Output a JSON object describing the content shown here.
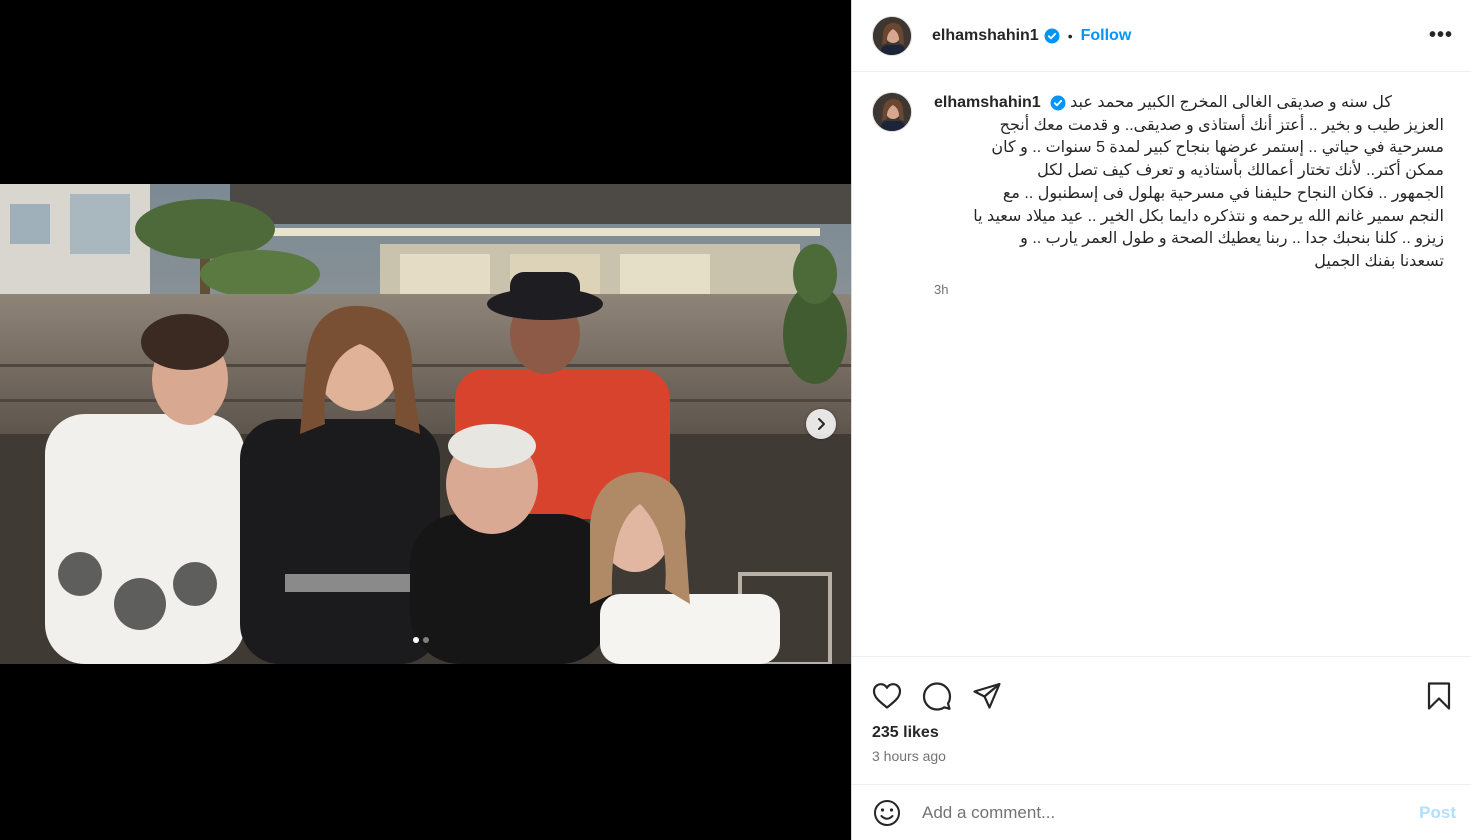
{
  "post": {
    "username": "elhamshahin1",
    "follow_label": "Follow",
    "separator": "•",
    "more_label": "•••",
    "caption_lines": [
      "كل سنه و صديقى الغالى المخرج الكبير محمد عبد",
      "العزيز طيب و بخير .. أعتز أنك أستاذى و صديقى.. و قدمت معك أنجح",
      "مسرحية في حياتي .. إستمر عرضها بنجاح كبير لمدة 5 سنوات .. و كان",
      "ممكن أكتر.. لأنك تختار أعمالك بأستاذيه و تعرف كيف تصل لكل",
      "الجمهور .. فكان النجاح حليفنا في مسرحية بهلول فى إسطنبول .. مع",
      "النجم سمير غانم الله يرحمه و نتذكره دايما بكل الخير .. عيد ميلاد سعيد يا",
      "زيزو .. كلنا بنحبك جدا .. ربنا يعطيك الصحة و طول العمر يارب .. و",
      "تسعدنا بفنك الجميل"
    ],
    "caption_time": "3h",
    "likes": "235 likes",
    "posted_ago": "3 hours ago"
  },
  "comment": {
    "placeholder": "Add a comment...",
    "post_label": "Post"
  },
  "carousel": {
    "current": 1,
    "total": 2
  },
  "colors": {
    "accent": "#0095f6",
    "post_disabled": "#b2dffc",
    "muted": "#737373",
    "border": "#dbdbdb"
  },
  "icons": {
    "verified": "verified-badge-icon",
    "like": "heart-icon",
    "comment": "comment-bubble-icon",
    "share": "paper-plane-icon",
    "save": "bookmark-icon",
    "emoji": "smiley-icon",
    "next": "chevron-right-icon"
  }
}
